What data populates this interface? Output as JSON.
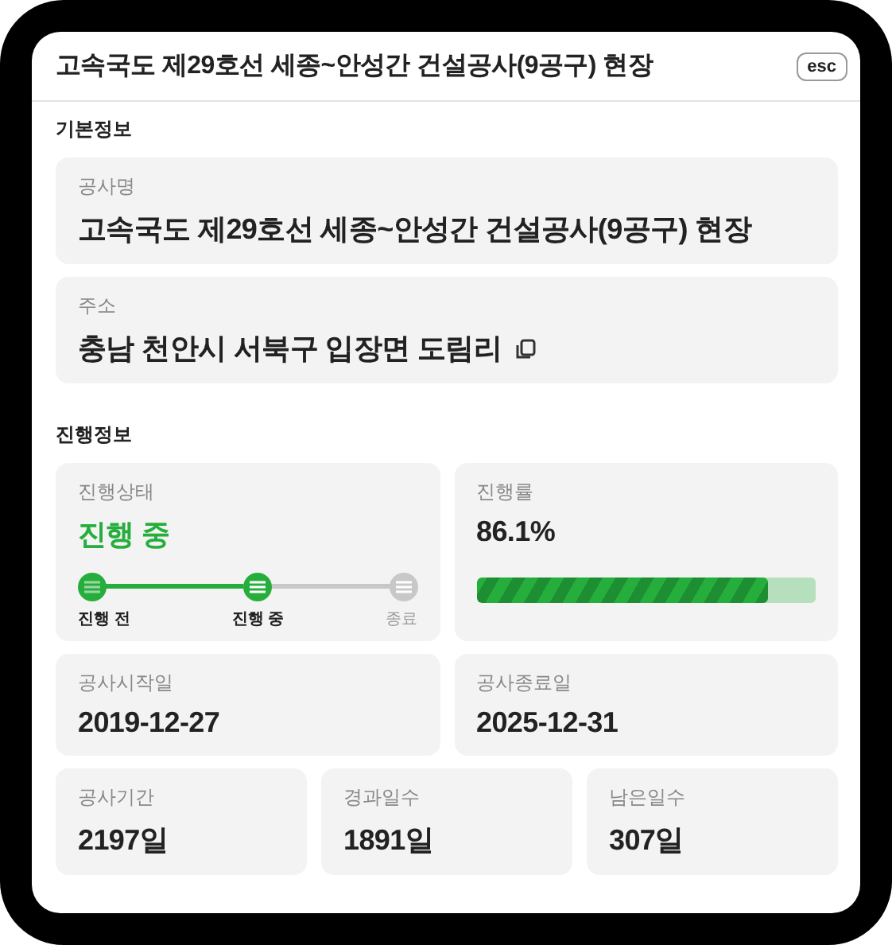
{
  "header": {
    "title": "고속국도 제29호선 세종~안성간 건설공사(9공구) 현장",
    "close_button": "esc"
  },
  "basic_info": {
    "heading": "기본정보",
    "fields": [
      {
        "label": "공사명",
        "value": "고속국도 제29호선 세종~안성간 건설공사(9공구) 현장",
        "copyable": false
      },
      {
        "label": "주소",
        "value": "충남 천안시 서북구 입장면 도림리",
        "copyable": true
      }
    ]
  },
  "progress_info": {
    "heading": "진행정보",
    "status": {
      "label": "진행상태",
      "value": "진행 중",
      "steps": [
        {
          "label": "진행 전",
          "kind": "done"
        },
        {
          "label": "진행 중",
          "kind": "current"
        },
        {
          "label": "종료",
          "kind": "pending"
        }
      ]
    },
    "rate": {
      "label": "진행률",
      "value": "86.1%",
      "level": 0.861
    },
    "dates": [
      {
        "label": "공사시작일",
        "value": "2019-12-27"
      },
      {
        "label": "공사종료일",
        "value": "2025-12-31"
      }
    ],
    "days": [
      {
        "label": "공사기간",
        "value": "2197일"
      },
      {
        "label": "경과일수",
        "value": "1891일"
      },
      {
        "label": "남은일수",
        "value": "307일"
      }
    ]
  }
}
